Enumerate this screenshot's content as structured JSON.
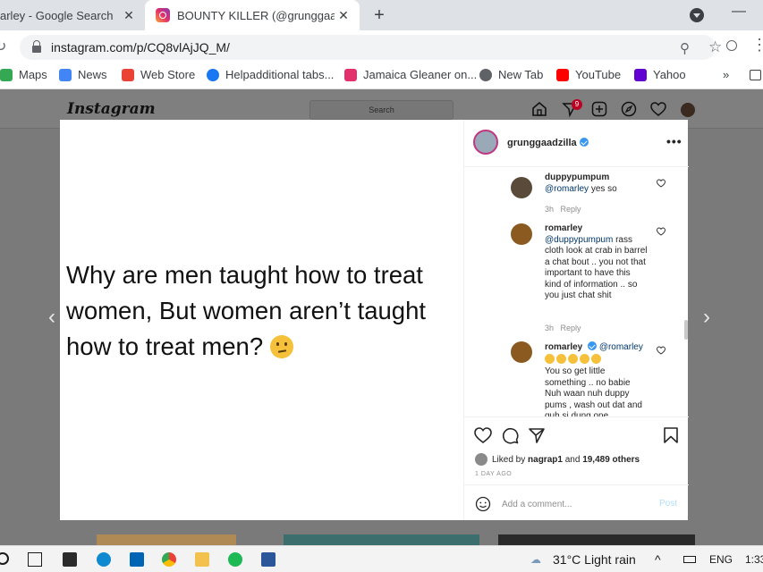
{
  "browser": {
    "tabs": [
      {
        "title": "arley - Google Search"
      },
      {
        "title": "BOUNTY KILLER (@grunggaadzilla"
      }
    ],
    "tab_close": "✕",
    "new_tab": "+",
    "url": "instagram.com/p/CQ8vlAjJQ_M/",
    "bookmarks": [
      {
        "label": "Maps",
        "color": "#34a853"
      },
      {
        "label": "News",
        "color": "#4285f4"
      },
      {
        "label": "Web Store",
        "color": "#ea4335"
      },
      {
        "label": "Helpadditional tabs...",
        "color": "#1877f2"
      },
      {
        "label": "Jamaica Gleaner on...",
        "color": "#e1306c"
      },
      {
        "label": "New Tab",
        "color": "#5f6368"
      },
      {
        "label": "YouTube",
        "color": "#ff0000"
      },
      {
        "label": "Yahoo",
        "color": "#6001d2"
      }
    ],
    "bookmarks_more": "»"
  },
  "instagram": {
    "logo": "Instagram",
    "search_placeholder": "Search",
    "notification_count": "9",
    "post": {
      "text": "Why are men taught how to treat women, But women aren’t taught how to treat men?",
      "author": "grunggaadzilla",
      "more": "•••"
    },
    "comments": [
      {
        "user": "duppypumpum",
        "mention": "@romarley",
        "text": " yes so",
        "time": "3h",
        "reply": "Reply"
      },
      {
        "user": "romarley",
        "mention": "@duppypumpum",
        "text": " rass cloth look at crab in barrel a chat bout .. you not that important to have this kind of information .. so you just chat shit",
        "time": "3h",
        "reply": "Reply"
      },
      {
        "user": "romarley",
        "mention": "@romarley",
        "text": "You so get little something .. no babie Nuh waan nuh duppy pums , wash out dat and quh si dung one",
        "time": "",
        "reply": ""
      }
    ],
    "likes": {
      "prefix": "Liked by ",
      "user": "nagrap1",
      "middle": " and ",
      "count": "19,489 others"
    },
    "time_ago": "1 DAY AGO",
    "add_comment_placeholder": "Add a comment...",
    "post_button": "Post"
  },
  "taskbar": {
    "weather": "31°C  Light rain",
    "language": "ENG",
    "clock": "1:33"
  },
  "colors": {
    "instagram_blue": "#3897f0",
    "tab_strip": "#dee1e6"
  }
}
